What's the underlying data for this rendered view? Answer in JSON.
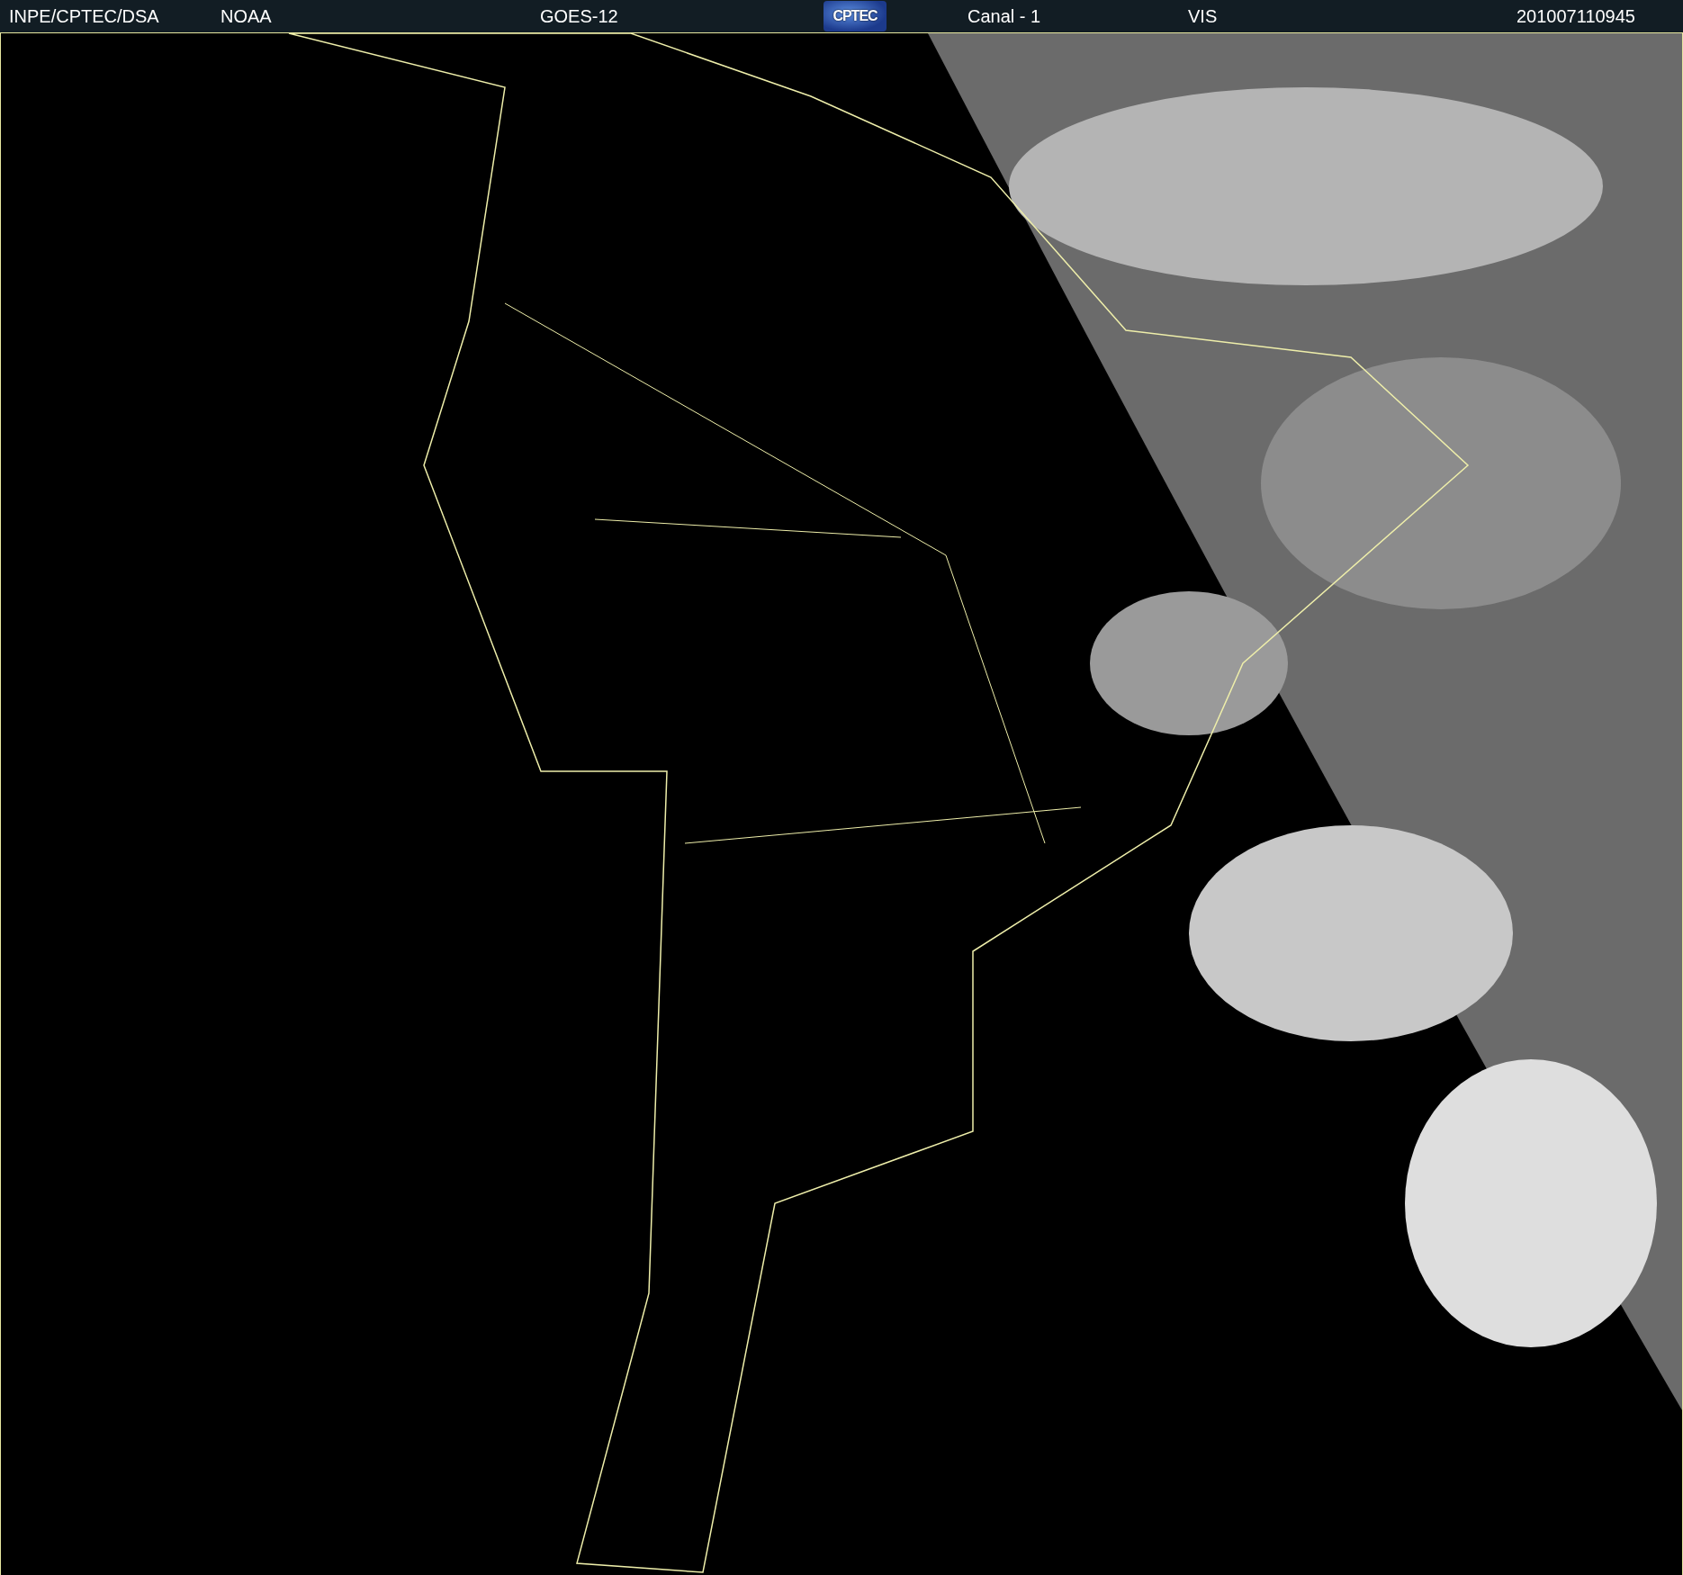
{
  "header": {
    "items": [
      {
        "kind": "text",
        "text": "INPE/CPTEC/DSA"
      },
      {
        "kind": "text",
        "text": "NOAA"
      },
      {
        "kind": "text",
        "text": "GOES-12"
      },
      {
        "kind": "logo",
        "text": "CPTEC"
      },
      {
        "kind": "text",
        "text": "Canal - 1"
      },
      {
        "kind": "text",
        "text": "VIS"
      },
      {
        "kind": "text",
        "text": "201007110945"
      }
    ]
  }
}
